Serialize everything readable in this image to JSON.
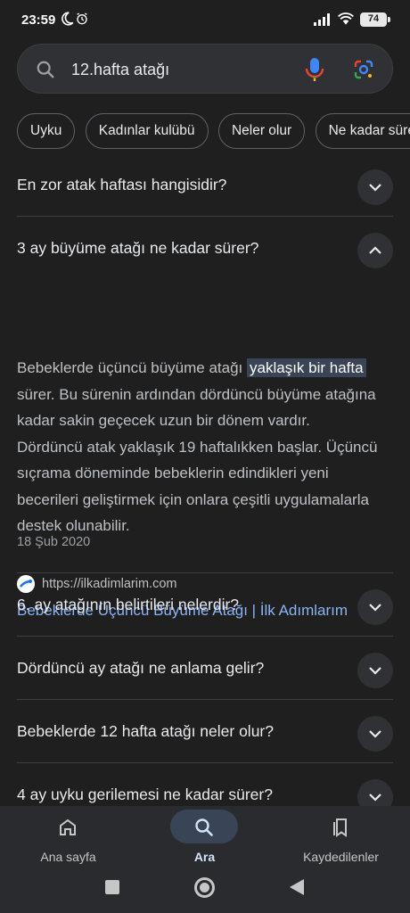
{
  "status_bar": {
    "time": "23:59",
    "battery": "74"
  },
  "search": {
    "query": "12.hafta atağı"
  },
  "chips": [
    {
      "label": "Uyku"
    },
    {
      "label": "Kadınlar kulübü"
    },
    {
      "label": "Neler olur"
    },
    {
      "label": "Ne kadar sürer"
    }
  ],
  "faq": {
    "q1": "En zor atak haftası hangisidir?",
    "q2": "3 ay büyüme atağı ne kadar sürer?",
    "answer": {
      "before": "Bebeklerde üçüncü büyüme atağı ",
      "highlight": "yaklaşık bir hafta",
      "after": " sürer. Bu sürenin ardından dördüncü büyüme atağına kadar sakin geçecek uzun bir dönem vardır. Dördüncü atak yaklaşık 19 haftalıkken başlar. Üçüncü sıçrama döneminde bebeklerin edindikleri yeni becerileri geliştirmek için onlara çeşitli uygulamalarla destek olunabilir.",
      "date": "18 Şub 2020",
      "source_url": "https://ilkadimlarim.com",
      "source_title": "Bebeklerde Üçüncü Büyüme Atağı | İlk Adımlarım"
    },
    "q3": "6. ay atağının belirtileri nelerdir?",
    "q4": "Dördüncü ay atağı ne anlama gelir?",
    "q5": "Bebeklerde 12 hafta atağı neler olur?",
    "q6": "4 ay uyku gerilemesi ne kadar sürer?"
  },
  "bottom_nav": {
    "home": "Ana sayfa",
    "search": "Ara",
    "saved": "Kaydedilenler"
  },
  "colors": {
    "accent": "#8ab4f8",
    "highlight_bg": "#394457"
  }
}
